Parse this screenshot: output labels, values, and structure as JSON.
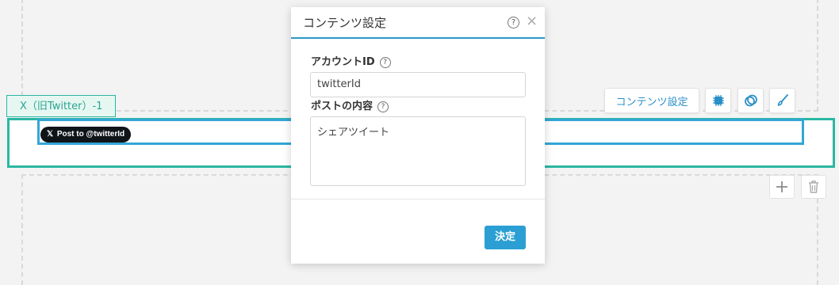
{
  "canvas": {
    "block_tag": "X（旧Twitter）-1",
    "post_button_label": "Post to @twitterId",
    "post_button_logo": "𝕏"
  },
  "toolbar": {
    "content_settings_label": "コンテンツ設定",
    "icons": [
      "chip-icon",
      "layers-icon",
      "brush-icon"
    ]
  },
  "side_actions": {
    "icons": [
      "plus-icon",
      "trash-icon"
    ]
  },
  "dialog": {
    "title": "コンテンツ設定",
    "help_glyph": "?",
    "close_glyph": "×",
    "fields": {
      "account_id": {
        "label": "アカウントID",
        "value": "twitterId"
      },
      "post_content": {
        "label": "ポストの内容",
        "value": "シェアツイート"
      }
    },
    "ok_label": "決定"
  },
  "colors": {
    "accent_blue": "#2b9fd3",
    "frame_green": "#2bb7a2",
    "frame_blue": "#33a6d6"
  }
}
